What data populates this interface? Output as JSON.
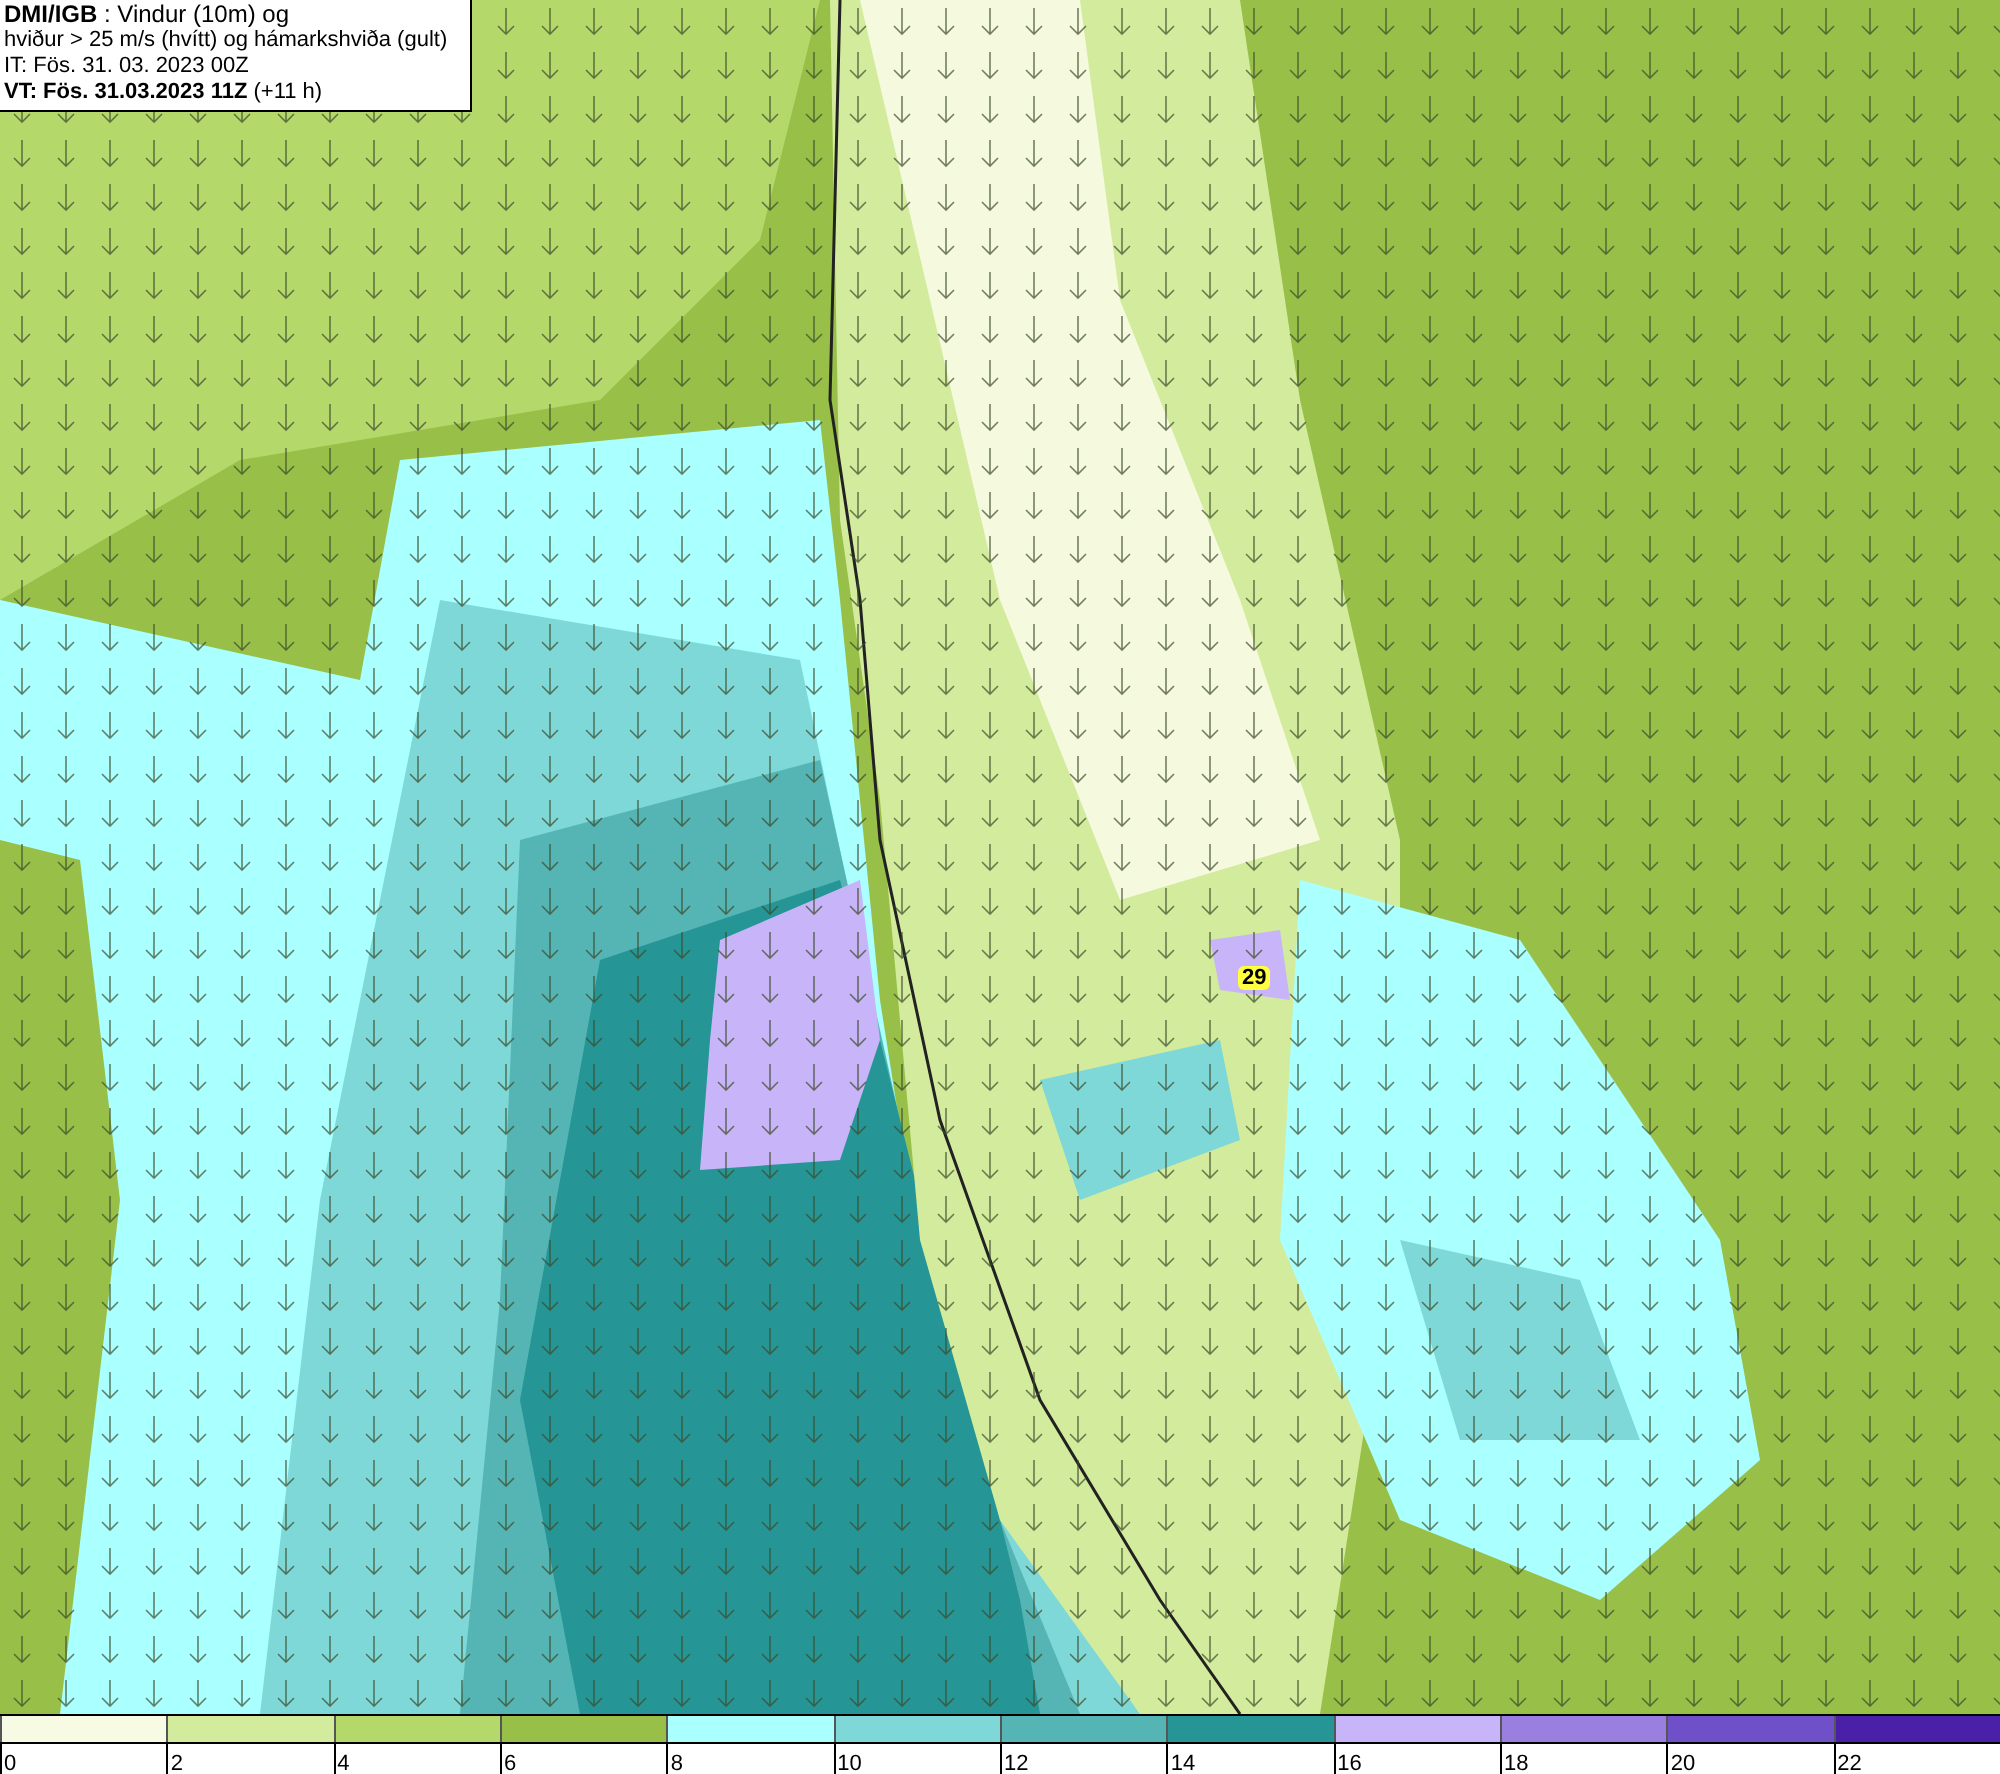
{
  "header": {
    "lines": [
      "**DMI/IGB** : Vindur (10m) og",
      "hviður > 25 m/s (hvítt) og hámarkshviða (gult)",
      "IT: Fös. 31. 03. 2023 00Z",
      "**VT: Fös. 31.03.2023 11Z** (+11 h)"
    ]
  },
  "map": {
    "gust_labels": [
      {
        "text": "29"
      }
    ]
  },
  "legend": {
    "bins": [
      {
        "color": "#f8fbe4"
      },
      {
        "color": "#d3eb9c"
      },
      {
        "color": "#b5d86b"
      },
      {
        "color": "#98c048"
      },
      {
        "color": "#aaffff"
      },
      {
        "color": "#7fd8d8"
      },
      {
        "color": "#55b5b5"
      },
      {
        "color": "#259595"
      },
      {
        "color": "#c8b4f8"
      },
      {
        "color": "#9a7ee0"
      },
      {
        "color": "#7050c8"
      },
      {
        "color": "#4a20a8"
      }
    ],
    "labels": [
      "0",
      "2",
      "4",
      "6",
      "8",
      "10",
      "12",
      "14",
      "16",
      "18",
      "20",
      "22"
    ]
  }
}
